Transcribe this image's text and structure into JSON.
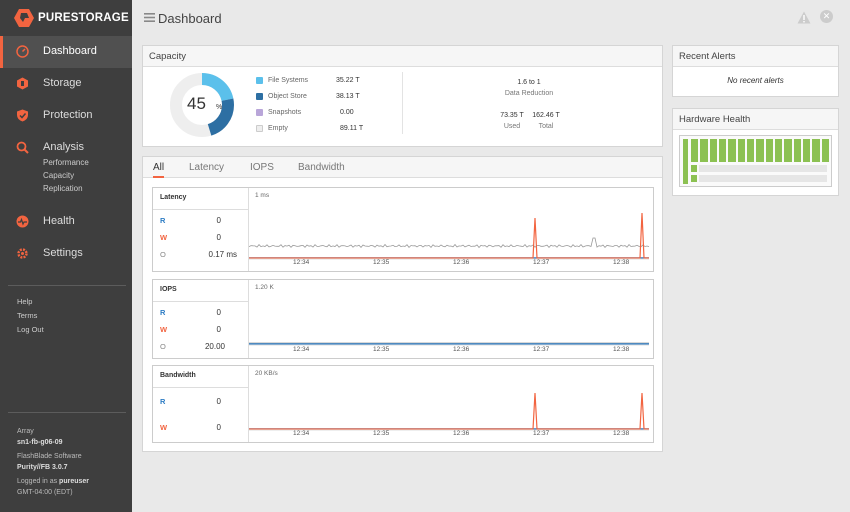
{
  "brand": "PURESTORAGE",
  "nav": {
    "dashboard": "Dashboard",
    "storage": "Storage",
    "protection": "Protection",
    "analysis": "Analysis",
    "analysis_sub": [
      "Performance",
      "Capacity",
      "Replication"
    ],
    "health": "Health",
    "settings": "Settings"
  },
  "links": {
    "help": "Help",
    "terms": "Terms",
    "logout": "Log Out"
  },
  "array_info": {
    "array_label": "Array",
    "array_name": "sn1-fb-g06-09",
    "software_label": "FlashBlade Software",
    "software_version": "Purity//FB 3.0.7",
    "logged_in_prefix": "Logged in as",
    "user": "pureuser",
    "timezone": "GMT-04:00 (EDT)"
  },
  "header": {
    "title": "Dashboard"
  },
  "capacity": {
    "title": "Capacity",
    "percent": "45",
    "percent_unit": "%",
    "legend": [
      {
        "name": "File Systems",
        "value": "35.22 T",
        "color": "#5bc0eb"
      },
      {
        "name": "Object Store",
        "value": "38.13 T",
        "color": "#2d6fa3"
      },
      {
        "name": "Snapshots",
        "value": "0.00",
        "color": "#b9a6d9"
      },
      {
        "name": "Empty",
        "value": "89.11 T",
        "color": "#eeeeee"
      }
    ],
    "reduction_value": "1.6 to 1",
    "reduction_label": "Data Reduction",
    "used_value": "73.35 T",
    "used_label": "Used",
    "total_value": "162.46 T",
    "total_label": "Total",
    "ring_fractions": {
      "file_systems": 0.217,
      "object_store": 0.235
    }
  },
  "alerts": {
    "title": "Recent Alerts",
    "empty": "No recent alerts"
  },
  "hardware": {
    "title": "Hardware Health",
    "blade_count": 15
  },
  "perf": {
    "tabs": [
      "All",
      "Latency",
      "IOPS",
      "Bandwidth"
    ],
    "active_tab": "All",
    "time_labels": [
      "12:34",
      "12:35",
      "12:36",
      "12:37",
      "12:38"
    ],
    "latency": {
      "label": "Latency",
      "r_label": "R",
      "w_label": "W",
      "o_label": "O",
      "r": "0",
      "w": "0",
      "o": "0.17 ms",
      "scale": "1 ms"
    },
    "iops": {
      "label": "IOPS",
      "r_label": "R",
      "w_label": "W",
      "o_label": "O",
      "r": "0",
      "w": "0",
      "o": "20.00",
      "scale": "1.20 K"
    },
    "bandwidth": {
      "label": "Bandwidth",
      "r_label": "R",
      "w_label": "W",
      "r": "0",
      "w": "0",
      "scale": "20 KB/s"
    }
  },
  "colors": {
    "accent": "#f26440",
    "read": "#2d7cc4",
    "write": "#f26440",
    "other": "#888888",
    "health": "#8cc152"
  }
}
